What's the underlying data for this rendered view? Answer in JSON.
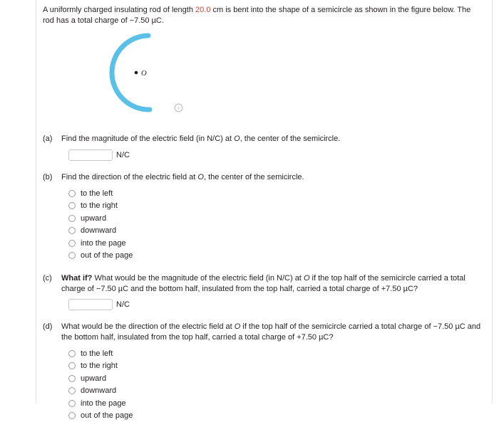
{
  "problem": {
    "text_before_value": "A uniformly charged insulating rod of length ",
    "highlighted_value": "20.0",
    "text_after_value": " cm is bent into the shape of a semicircle as shown in the figure below. The rod has a total charge of −7.50 µC.",
    "highlight_color": "#d0442f"
  },
  "figure": {
    "arc_color": "#5bc0e8",
    "center_point_label": "O",
    "helper_icon": "info-circle-icon"
  },
  "parts": [
    {
      "label": "(a)",
      "prompt_plain": "Find the magnitude of the electric field (in N/C) at ",
      "prompt_italic": "O",
      "prompt_tail": ", the center of the semicircle.",
      "answer_value": "",
      "answer_placeholder": "",
      "unit": "N/C"
    },
    {
      "label": "(b)",
      "prompt_plain": "Find the direction of the electric field at ",
      "prompt_italic": "O",
      "prompt_tail": ", the center of the semicircle.",
      "options": [
        "to the left",
        "to the right",
        "upward",
        "downward",
        "into the page",
        "out of the page"
      ],
      "selected": null
    },
    {
      "label": "(c)",
      "bold_lead": "What if?",
      "prompt_plain": " What would be the magnitude of the electric field (in N/C) at ",
      "prompt_italic": "O",
      "prompt_tail": " if the top half of the semicircle carried a total charge of −7.50 µC and the bottom half, insulated from the top half, carried a total charge of +7.50 µC?",
      "answer_value": "",
      "answer_placeholder": "",
      "unit": "N/C"
    },
    {
      "label": "(d)",
      "prompt_plain": "What would be the direction of the electric field at ",
      "prompt_italic": "O",
      "prompt_tail": " if the top half of the semicircle carried a total charge of −7.50 µC and the bottom half, insulated from the top half, carried a total charge of +7.50 µC?",
      "options": [
        "to the left",
        "to the right",
        "upward",
        "downward",
        "into the page",
        "out of the page"
      ],
      "selected": null
    }
  ]
}
